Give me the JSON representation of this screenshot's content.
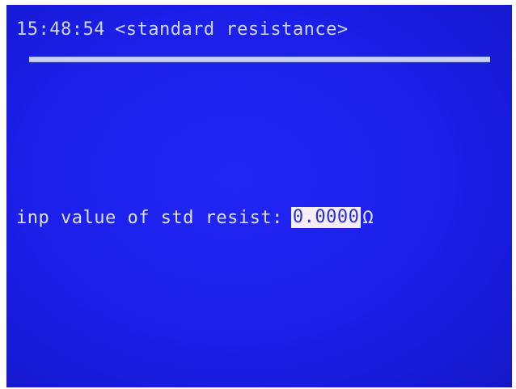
{
  "header": {
    "time": "15:48:54",
    "title": "<standard resistance>"
  },
  "prompt": {
    "label": "inp value of std resist:",
    "value": "0.0000",
    "unit": "Ω"
  }
}
